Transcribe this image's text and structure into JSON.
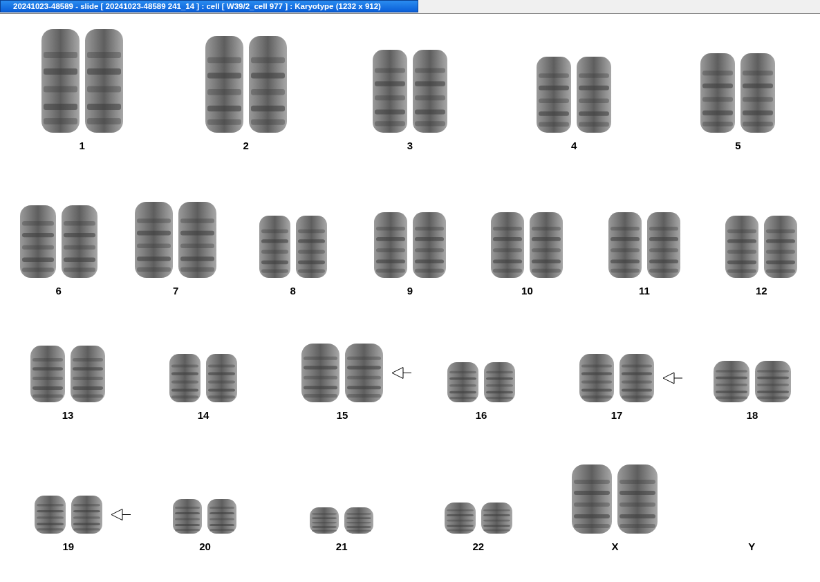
{
  "window": {
    "title": "20241023-48589 - slide [ 20241023-48589 241_14 ] : cell [ W39/2_cell 977 ] : Karyotype  (1232 x 912)"
  },
  "rows": [
    {
      "pairs": [
        {
          "label": "1",
          "kind": "pair",
          "marked": false
        },
        {
          "label": "2",
          "kind": "pair",
          "marked": false
        },
        {
          "label": "3",
          "kind": "pair",
          "marked": false
        },
        {
          "label": "4",
          "kind": "pair",
          "marked": false
        },
        {
          "label": "5",
          "kind": "pair",
          "marked": false
        }
      ]
    },
    {
      "pairs": [
        {
          "label": "6",
          "kind": "pair",
          "marked": false
        },
        {
          "label": "7",
          "kind": "pair",
          "marked": false
        },
        {
          "label": "8",
          "kind": "pair",
          "marked": false
        },
        {
          "label": "9",
          "kind": "pair",
          "marked": false
        },
        {
          "label": "10",
          "kind": "pair",
          "marked": false
        },
        {
          "label": "11",
          "kind": "pair",
          "marked": false
        },
        {
          "label": "12",
          "kind": "pair",
          "marked": false
        }
      ]
    },
    {
      "pairs": [
        {
          "label": "13",
          "kind": "pair",
          "marked": false
        },
        {
          "label": "14",
          "kind": "pair",
          "marked": false
        },
        {
          "label": "15",
          "kind": "pair",
          "marked": true
        },
        {
          "label": "16",
          "kind": "pair",
          "marked": false
        },
        {
          "label": "17",
          "kind": "pair",
          "marked": true
        },
        {
          "label": "18",
          "kind": "pair",
          "marked": false
        }
      ]
    },
    {
      "pairs": [
        {
          "label": "19",
          "kind": "pair",
          "marked": true
        },
        {
          "label": "20",
          "kind": "pair",
          "marked": false
        },
        {
          "label": "21",
          "kind": "pair",
          "marked": false
        },
        {
          "label": "22",
          "kind": "pair",
          "marked": false
        },
        {
          "label": "X",
          "kind": "pair",
          "marked": false
        },
        {
          "label": "Y",
          "kind": "empty"
        }
      ]
    }
  ]
}
